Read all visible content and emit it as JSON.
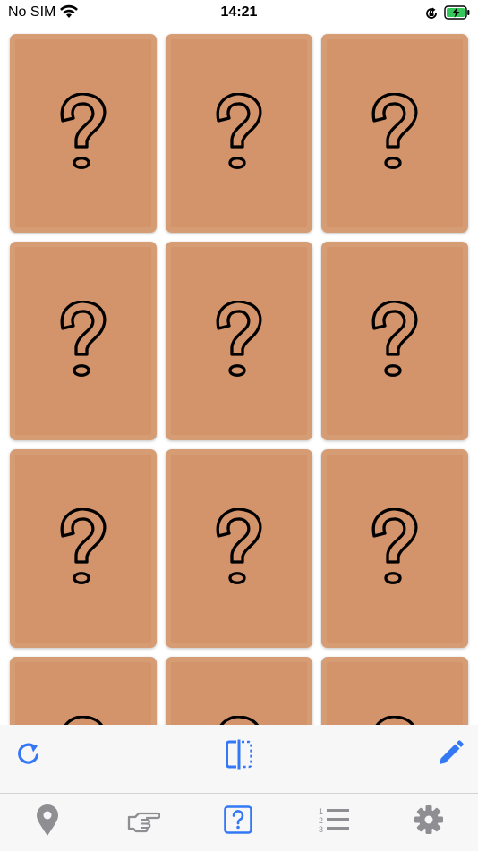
{
  "status_bar": {
    "carrier": "No SIM",
    "time": "14:21"
  },
  "game": {
    "card_back_symbol": "question-mark-icon",
    "card_color": "#d69c74",
    "card_inner_color": "#d3936b",
    "cards": [
      {
        "state": "face-down"
      },
      {
        "state": "face-down"
      },
      {
        "state": "face-down"
      },
      {
        "state": "face-down"
      },
      {
        "state": "face-down"
      },
      {
        "state": "face-down"
      },
      {
        "state": "face-down"
      },
      {
        "state": "face-down"
      },
      {
        "state": "face-down"
      },
      {
        "state": "face-down"
      },
      {
        "state": "face-down"
      },
      {
        "state": "face-down"
      }
    ]
  },
  "toolbar": {
    "accent_color": "#3478f6",
    "left_icon": "refresh-icon",
    "center_icon": "split-view-icon",
    "right_icon": "pencil-icon"
  },
  "tab_bar": {
    "inactive_color": "#8e8e93",
    "active_color": "#3478f6",
    "tabs": [
      {
        "icon": "location-pin-icon",
        "active": false
      },
      {
        "icon": "pointing-hand-icon",
        "active": false
      },
      {
        "icon": "question-box-icon",
        "active": true
      },
      {
        "icon": "numbered-list-icon",
        "active": false
      },
      {
        "icon": "gear-icon",
        "active": false
      }
    ]
  }
}
